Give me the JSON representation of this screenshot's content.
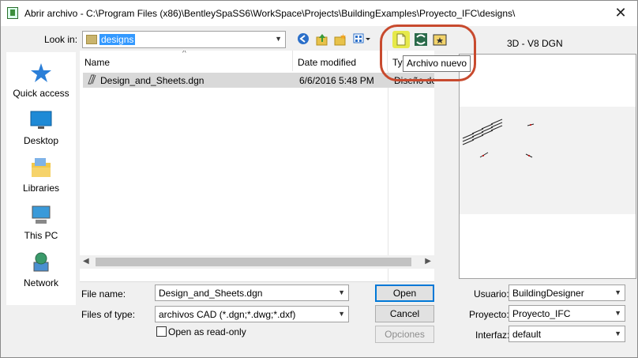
{
  "window": {
    "title": "Abrir archivo - C:\\Program Files (x86)\\BentleySpaSS6\\WorkSpace\\Projects\\BuildingExamples\\Proyecto_IFC\\designs\\",
    "close_glyph": "✕"
  },
  "toolbar": {
    "look_in_label": "Look in:",
    "look_in_value": "designs",
    "icons": [
      "back-icon",
      "up-folder-icon",
      "new-folder-icon",
      "view-menu-icon",
      "new-file-icon",
      "refresh-icon",
      "workspace-folder-icon"
    ],
    "tooltip": "Archivo nuevo"
  },
  "places": [
    {
      "label": "Quick access",
      "icon": "star-icon"
    },
    {
      "label": "Desktop",
      "icon": "desktop-icon"
    },
    {
      "label": "Libraries",
      "icon": "libraries-icon"
    },
    {
      "label": "This PC",
      "icon": "pc-icon"
    },
    {
      "label": "Network",
      "icon": "network-icon"
    }
  ],
  "file_list": {
    "columns": [
      "Name",
      "Date modified",
      "Ty"
    ],
    "rows": [
      {
        "name": "Design_and_Sheets.dgn",
        "date": "6/6/2016 5:48 PM",
        "type": "Diseño de"
      }
    ]
  },
  "form": {
    "file_name_label": "File name:",
    "file_name_value": "Design_and_Sheets.dgn",
    "files_of_type_label": "Files of type:",
    "files_of_type_value": "archivos CAD (*.dgn;*.dwg;*.dxf)",
    "read_only_label": "Open as read-only"
  },
  "buttons": {
    "open": "Open",
    "cancel": "Cancel",
    "options": "Opciones"
  },
  "preview": {
    "title": "3D - V8 DGN"
  },
  "settings": {
    "user_label": "Usuario:",
    "user_value": "BuildingDesigner",
    "project_label": "Proyecto:",
    "project_value": "Proyecto_IFC",
    "interface_label": "Interfaz:",
    "interface_value": "default"
  },
  "colors": {
    "selection": "#3399ff",
    "highlight_ring": "#c84a2e",
    "row_selected": "#d9d9d9"
  }
}
